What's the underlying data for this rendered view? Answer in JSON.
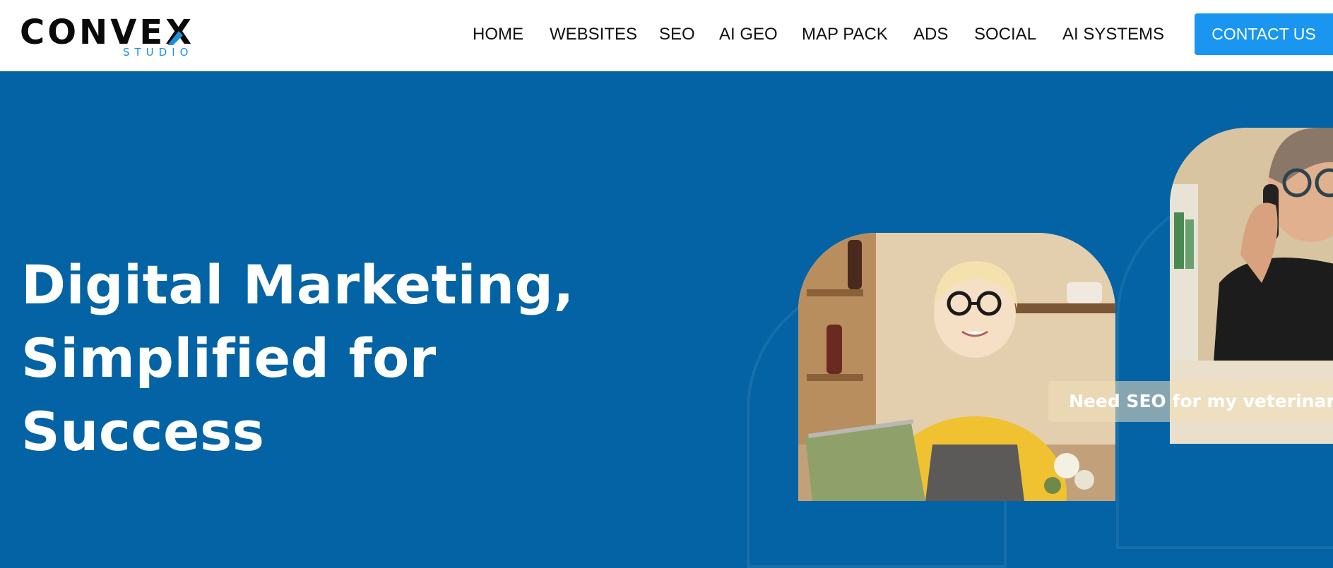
{
  "brand": {
    "name_prefix": "CONVE",
    "name_x": "X",
    "tagline": "STUDIO",
    "accent_color": "#1d8fe0"
  },
  "nav": {
    "items": [
      {
        "label": "HOME"
      },
      {
        "label": "WEBSITES"
      },
      {
        "label": "SEO"
      },
      {
        "label": "AI GEO"
      },
      {
        "label": "MAP PACK"
      },
      {
        "label": "ADS"
      },
      {
        "label": "SOCIAL"
      },
      {
        "label": "AI SYSTEMS"
      }
    ],
    "cta_label": "CONTACT US",
    "cta_color": "#1a96f0"
  },
  "hero": {
    "title_lines": [
      "Digital Marketing,",
      "Simplified for",
      "Success"
    ],
    "background_color": "#0363a4",
    "chat_prompt": "Need SEO for my veterinarian"
  }
}
